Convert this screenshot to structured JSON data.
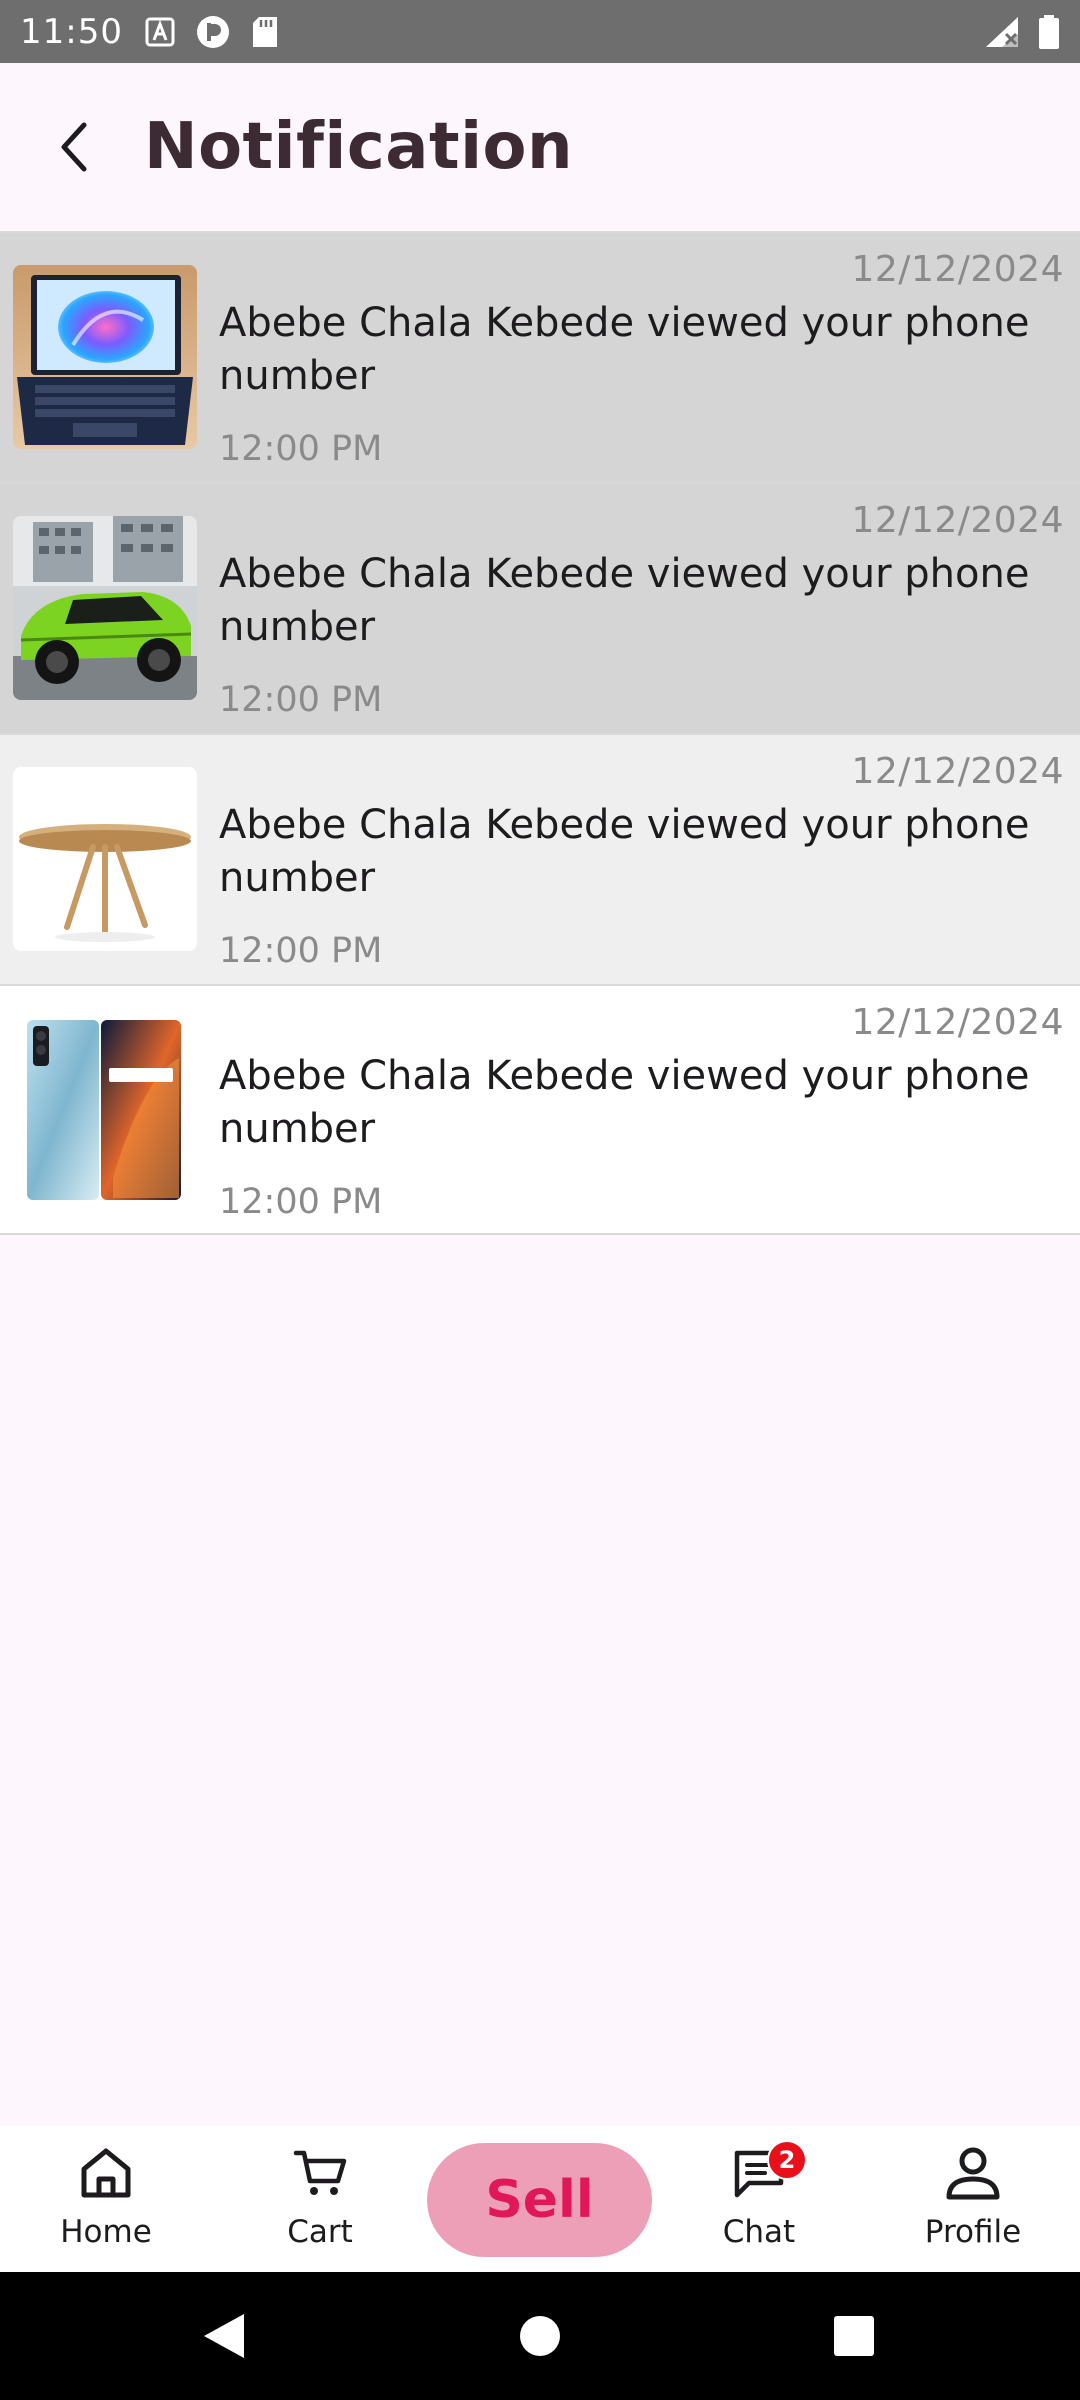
{
  "status_bar": {
    "time": "11:50",
    "left_icons": [
      "text-a-icon",
      "circle-p-icon",
      "sd-card-icon"
    ],
    "right_icons": [
      "signal-off-icon",
      "battery-icon"
    ]
  },
  "header": {
    "back_icon": "chevron-left-icon",
    "title": "Notification"
  },
  "notifications": [
    {
      "thumbnail": "laptop-image",
      "date": "12/12/2024",
      "text": "Abebe Chala Kebede viewed your phone number",
      "time": "12:00 PM",
      "background": "#d5d5d5"
    },
    {
      "thumbnail": "green-suv-image",
      "date": "12/12/2024",
      "text": "Abebe Chala Kebede viewed your phone number",
      "time": "12:00 PM",
      "background": "#d5d5d5"
    },
    {
      "thumbnail": "wooden-table-image",
      "date": "12/12/2024",
      "text": "Abebe Chala Kebede viewed your phone number",
      "time": "12:00 PM",
      "background": "#efefef"
    },
    {
      "thumbnail": "smartphone-image",
      "date": "12/12/2024",
      "text": "Abebe Chala Kebede viewed your phone number",
      "time": "12:00 PM",
      "background": "#ffffff"
    }
  ],
  "bottom_nav": {
    "home": {
      "label": "Home",
      "icon": "home-icon"
    },
    "cart": {
      "label": "Cart",
      "icon": "cart-icon"
    },
    "sell": {
      "label": "Sell"
    },
    "chat": {
      "label": "Chat",
      "icon": "chat-icon",
      "badge": "2"
    },
    "profile": {
      "label": "Profile",
      "icon": "profile-icon"
    }
  },
  "system_nav": [
    "back-triangle-icon",
    "home-circle-icon",
    "recents-square-icon"
  ],
  "colors": {
    "background": "#fdf7fd",
    "title": "#3c2b33",
    "sell_bg": "#ee9fb8",
    "sell_text": "#e0185a",
    "badge": "#e8101b",
    "meta_text": "#8a8a8a"
  }
}
